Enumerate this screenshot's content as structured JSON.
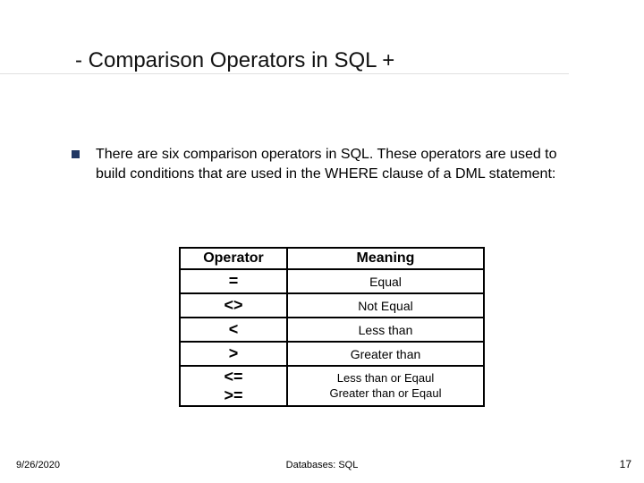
{
  "title": "- Comparison Operators in SQL +",
  "bullet": "There are six comparison operators in SQL. These operators are used to build conditions  that are used in the WHERE clause of a DML statement:",
  "table": {
    "headers": {
      "operator": "Operator",
      "meaning": "Meaning"
    },
    "rows": [
      {
        "op": "=",
        "mn": "Equal"
      },
      {
        "op": "<>",
        "mn": "Not Equal"
      },
      {
        "op": "<",
        "mn": "Less than"
      },
      {
        "op": ">",
        "mn": "Greater than"
      }
    ],
    "double": {
      "op1": "<=",
      "op2": ">=",
      "mn1": "Less  than or Eqaul",
      "mn2": "Greater  than or Eqaul"
    }
  },
  "footer": {
    "date": "9/26/2020",
    "center": "Databases: SQL",
    "page": "17"
  }
}
